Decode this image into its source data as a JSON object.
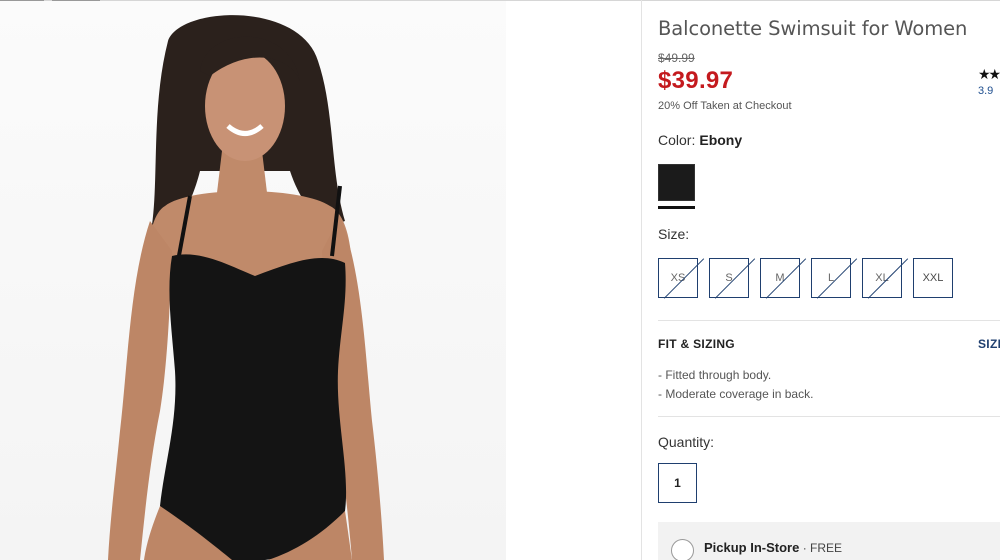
{
  "product": {
    "title": "Balconette Swimsuit for Women",
    "original_price": "$49.99",
    "sale_price": "$39.97",
    "promo_note": "20% Off Taken at Checkout",
    "rating_value": "3.9",
    "rating_stars": "★★",
    "color_label": "Color:",
    "color_value": "Ebony",
    "swatch_color": "#1b1b1b",
    "size_label": "Size:",
    "sizes": [
      {
        "label": "XS",
        "available": false
      },
      {
        "label": "S",
        "available": false
      },
      {
        "label": "M",
        "available": false
      },
      {
        "label": "L",
        "available": false
      },
      {
        "label": "XL",
        "available": false
      },
      {
        "label": "XXL",
        "available": true
      }
    ],
    "fit_heading": "FIT & SIZING",
    "size_chart_link": "SIZE",
    "fit_notes": [
      "Fitted through body.",
      "Moderate coverage in back."
    ],
    "quantity_label": "Quantity:",
    "quantity_value": "1",
    "pickup_label": "Pickup In-Store",
    "pickup_separator": " · ",
    "pickup_price": "FREE"
  },
  "colors": {
    "sale": "#c41a1e",
    "link": "#1f4f8f",
    "border": "#1f3f6f"
  }
}
